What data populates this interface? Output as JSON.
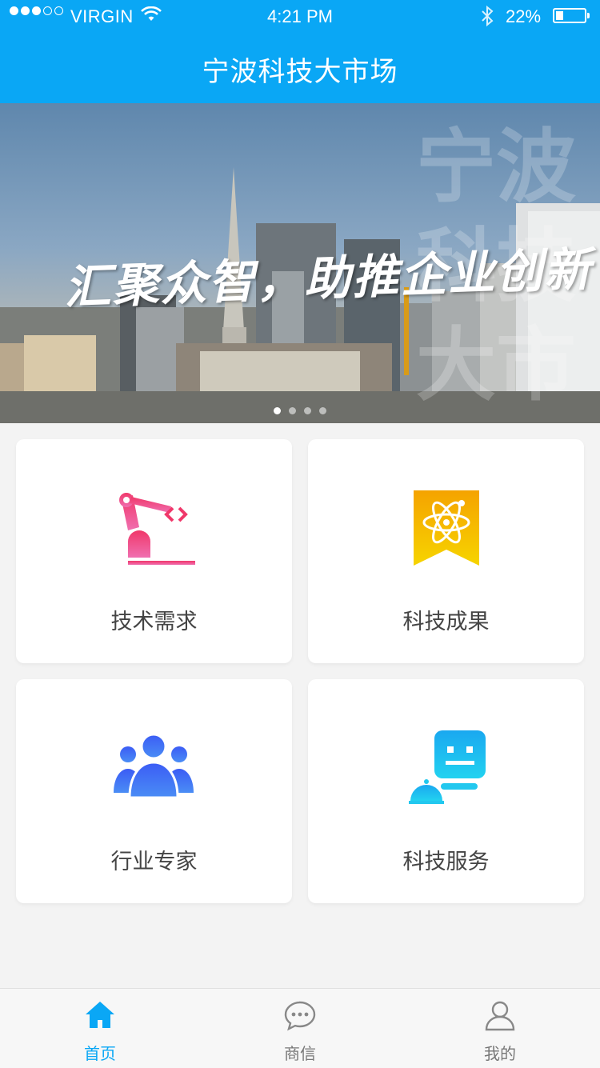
{
  "status_bar": {
    "carrier": "VIRGIN",
    "time": "4:21 PM",
    "battery": "22%",
    "battery_level": 0.22,
    "signal_bars": 3
  },
  "header": {
    "title": "宁波科技大市场"
  },
  "banner": {
    "slogan": "汇聚众智，助推企业创新",
    "watermark_text": "宁波科技大市场",
    "slides": 4,
    "active_slide": 1
  },
  "cards": [
    {
      "label": "技术需求",
      "icon": "robot-arm-icon"
    },
    {
      "label": "科技成果",
      "icon": "atom-ribbon-icon"
    },
    {
      "label": "行业专家",
      "icon": "people-group-icon"
    },
    {
      "label": "科技服务",
      "icon": "service-bot-icon"
    }
  ],
  "tabbar": {
    "items": [
      {
        "label": "首页",
        "icon": "home-icon",
        "active": true
      },
      {
        "label": "商信",
        "icon": "chat-icon",
        "active": false
      },
      {
        "label": "我的",
        "icon": "user-icon",
        "active": false
      }
    ]
  },
  "colors": {
    "primary": "#0aa7f5",
    "pink": "#f0437a",
    "yellow": "#f6b500",
    "blue": "#3b6bf5",
    "cyan": "#1ec8f2"
  }
}
